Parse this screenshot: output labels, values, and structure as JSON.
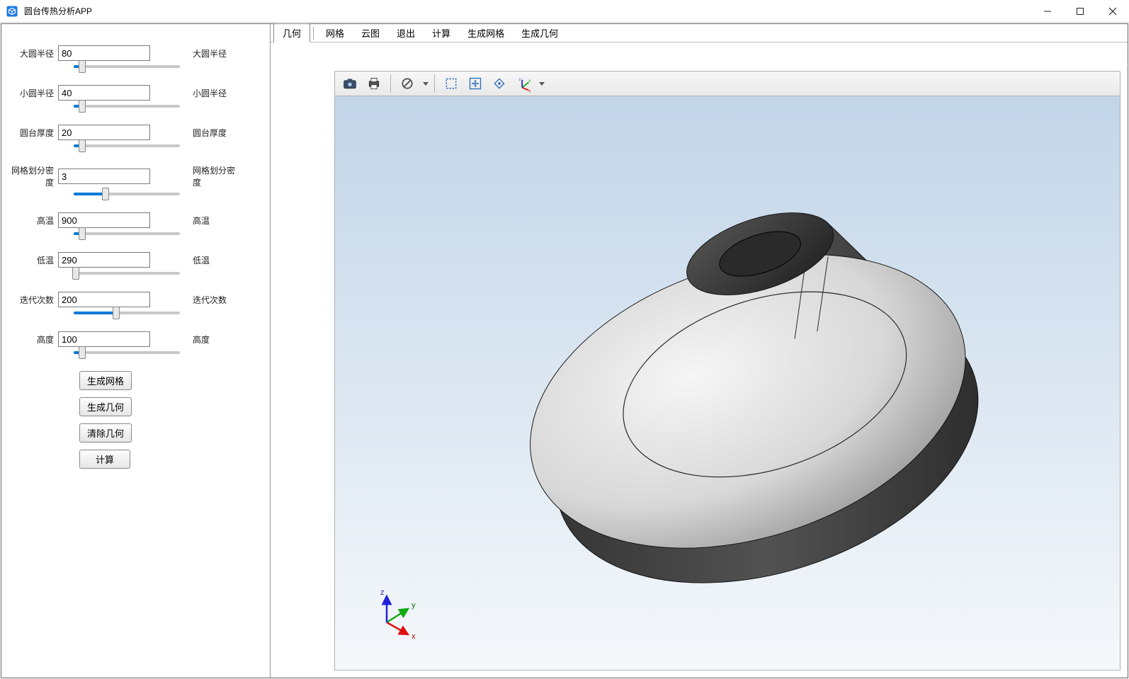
{
  "window": {
    "title": "圆台传热分析APP"
  },
  "menu": {
    "items": [
      "几何",
      "网格",
      "云图",
      "退出",
      "计算",
      "生成网格",
      "生成几何"
    ],
    "active_index": 0
  },
  "params": [
    {
      "key": "large_r",
      "label": "大圆半径",
      "value": "80",
      "right": "大圆半径",
      "slider": "default"
    },
    {
      "key": "small_r",
      "label": "小圆半径",
      "value": "40",
      "right": "小圆半径",
      "slider": "default"
    },
    {
      "key": "thickness",
      "label": "圆台厚度",
      "value": "20",
      "right": "圆台厚度",
      "slider": "default"
    },
    {
      "key": "mesh_d",
      "label": "网格划分密度",
      "value": "3",
      "right": "网格划分密度",
      "slider": "mesh"
    },
    {
      "key": "t_high",
      "label": "高温",
      "value": "900",
      "right": "高温",
      "slider": "default"
    },
    {
      "key": "t_low",
      "label": "低温",
      "value": "290",
      "right": "低温",
      "slider": "low"
    },
    {
      "key": "iters",
      "label": "迭代次数",
      "value": "200",
      "right": "迭代次数",
      "slider": "iters"
    },
    {
      "key": "height",
      "label": "高度",
      "value": "100",
      "right": "高度",
      "slider": "default"
    }
  ],
  "buttons": {
    "gen_mesh": "生成网格",
    "gen_geom": "生成几何",
    "clear_geom": "清除几何",
    "compute": "计算"
  },
  "toolbar_icons": [
    "camera",
    "print",
    "|",
    "forbid",
    "caret",
    "|",
    "select-box",
    "fit-view",
    "rotate-free",
    "axis-triad",
    "caret"
  ],
  "triad": {
    "x": "x",
    "y": "y",
    "z": "z"
  }
}
